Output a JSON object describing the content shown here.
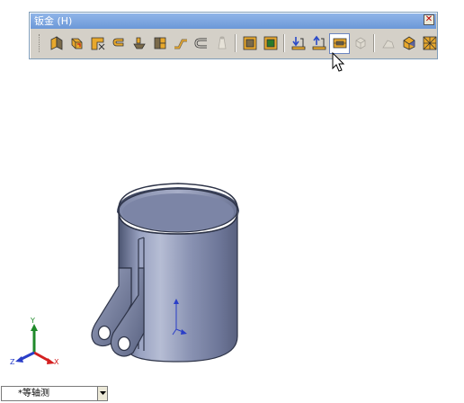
{
  "toolbar": {
    "title": "钣金 (H)",
    "close_symbol": "✕",
    "buttons": [
      {
        "icon": "base-flange-icon"
      },
      {
        "icon": "convert-to-sheet-metal-icon"
      },
      {
        "icon": "corner-trim-icon"
      },
      {
        "icon": "edge-flange-icon"
      },
      {
        "icon": "sketched-bend-icon"
      },
      {
        "icon": "closed-corner-icon"
      },
      {
        "icon": "jog-icon"
      },
      {
        "icon": "hem-icon"
      },
      {
        "icon": "lofted-bend-icon",
        "disabled": true
      },
      {
        "icon": "rip-icon"
      },
      {
        "icon": "insert-bends-icon"
      },
      {
        "icon": "unfold-icon"
      },
      {
        "icon": "fold-icon"
      },
      {
        "icon": "flatten-icon",
        "active": true
      },
      {
        "icon": "no-bends-icon",
        "disabled": true
      },
      {
        "icon": "form-tool-icon",
        "disabled": true
      },
      {
        "icon": "break-corner-icon"
      },
      {
        "icon": "mesh-icon"
      }
    ]
  },
  "view_selector": {
    "value": "*等轴测",
    "arrow": "▾"
  },
  "triad": {
    "x_label": "X",
    "y_label": "Y",
    "z_label": "Z"
  },
  "colors": {
    "toolbar_bg": "#d4d0c8",
    "title_bar": "#7aa3dd",
    "part_body": "#8a94b4",
    "part_shadow": "#4a536e",
    "axis_x": "#d42020",
    "axis_y": "#1f8a2a",
    "axis_z": "#2a3ec8"
  }
}
